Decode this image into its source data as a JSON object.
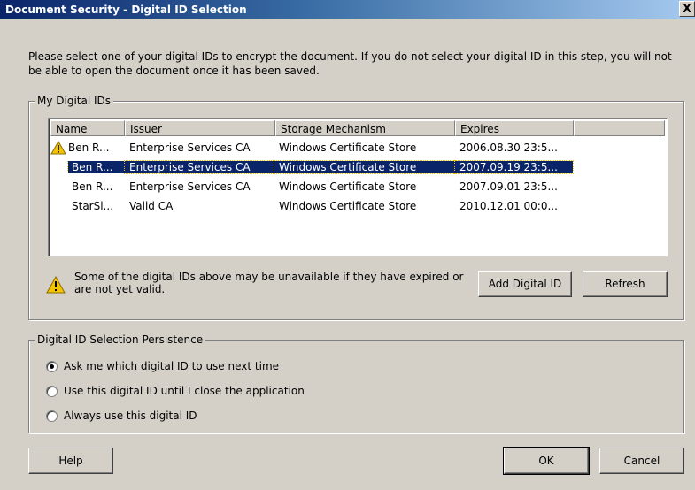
{
  "window": {
    "title": "Document Security - Digital ID Selection",
    "close_glyph": "X"
  },
  "intro_text": "Please select one of your digital IDs to encrypt the document. If you do not select your digital ID in this step, you will not be able to open the document once it has been saved.",
  "ids_group": {
    "legend": "My Digital IDs",
    "columns": [
      "Name",
      "Issuer",
      "Storage Mechanism",
      "Expires"
    ],
    "rows": [
      {
        "name": "Ben R...",
        "issuer": "Enterprise Services CA",
        "storage": "Windows Certificate Store",
        "expires": "2006.08.30 23:5...",
        "warning": true,
        "selected": false
      },
      {
        "name": "Ben R...",
        "issuer": "Enterprise Services CA",
        "storage": "Windows Certificate Store",
        "expires": "2007.09.19 23:5...",
        "warning": false,
        "selected": true
      },
      {
        "name": "Ben R...",
        "issuer": "Enterprise Services CA",
        "storage": "Windows Certificate Store",
        "expires": "2007.09.01 23:5...",
        "warning": false,
        "selected": false
      },
      {
        "name": "StarSi...",
        "issuer": "Valid CA",
        "storage": "Windows Certificate Store",
        "expires": "2010.12.01 00:0...",
        "warning": false,
        "selected": false
      }
    ],
    "warning_note": "Some of the digital IDs above may be unavailable if they have expired or are not yet valid.",
    "add_button": "Add Digital ID",
    "refresh_button": "Refresh"
  },
  "persistence_group": {
    "legend": "Digital ID Selection Persistence",
    "options": [
      {
        "label": "Ask me which digital ID to use next time",
        "checked": true
      },
      {
        "label": "Use this digital ID until I close the application",
        "checked": false
      },
      {
        "label": "Always use this digital ID",
        "checked": false
      }
    ]
  },
  "footer": {
    "help": "Help",
    "ok": "OK",
    "cancel": "Cancel"
  },
  "colors": {
    "title_start": "#0a246a",
    "title_end": "#a6caf0",
    "selection": "#0a246a",
    "warning": "#f5c400"
  },
  "icons": [
    "warning-icon",
    "close-icon"
  ]
}
